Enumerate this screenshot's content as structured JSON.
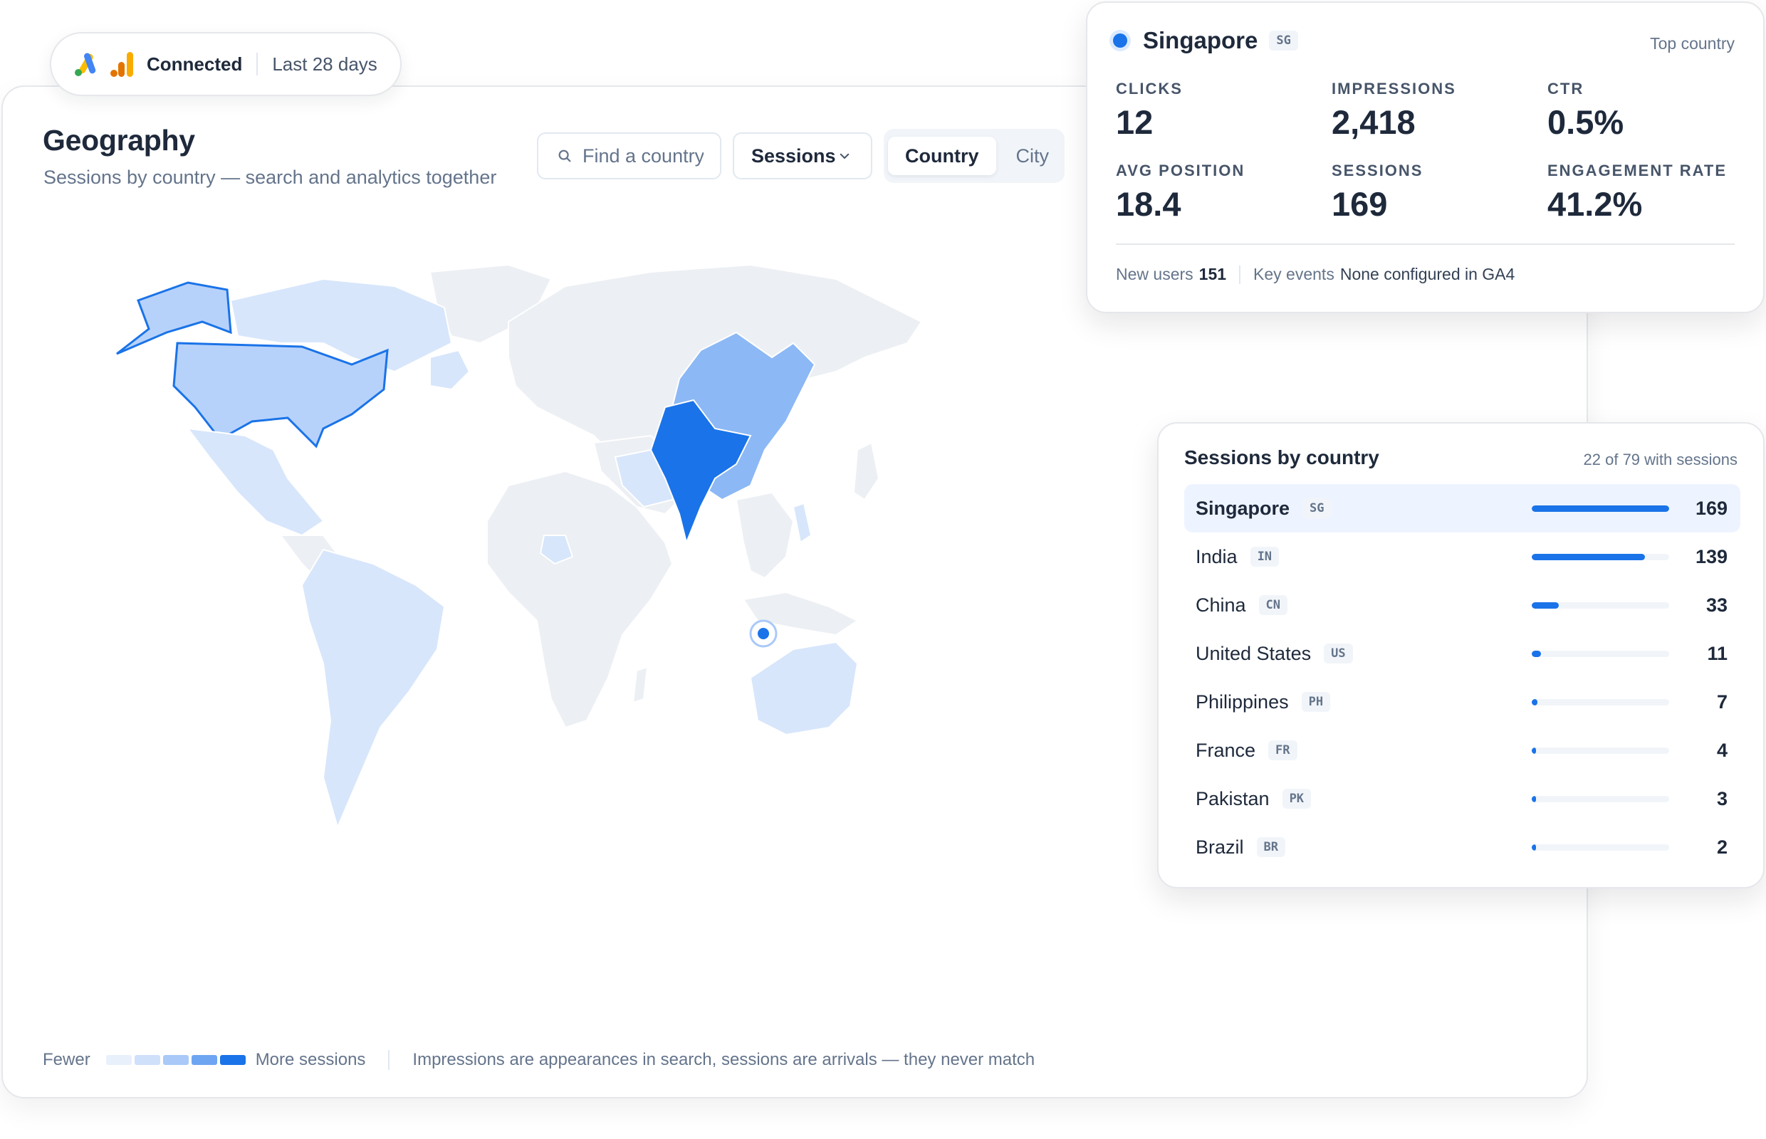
{
  "connection": {
    "status": "Connected",
    "range": "Last 28 days"
  },
  "header": {
    "title": "Geography",
    "subtitle": "Sessions by country — search and analytics together"
  },
  "toolbar": {
    "search_placeholder": "Find a country",
    "metric_select": "Sessions",
    "view_tabs": [
      {
        "label": "Country",
        "active": true
      },
      {
        "label": "City",
        "active": false
      }
    ]
  },
  "colors": {
    "accent": "#1a73e8",
    "scale": [
      "#e8f0fc",
      "#cfe0fb",
      "#a9c9f8",
      "#6ea5f2",
      "#1a73e8"
    ],
    "land_base": "#eceff3"
  },
  "top_country": {
    "name": "Singapore",
    "code": "SG",
    "tag": "Top country",
    "metrics": [
      {
        "label": "CLICKS",
        "value": "12"
      },
      {
        "label": "IMPRESSIONS",
        "value": "2,418"
      },
      {
        "label": "CTR",
        "value": "0.5%"
      },
      {
        "label": "AVG POSITION",
        "value": "18.4"
      },
      {
        "label": "SESSIONS",
        "value": "169"
      },
      {
        "label": "ENGAGEMENT RATE",
        "value": "41.2%"
      }
    ],
    "footer": {
      "new_users_label": "New users",
      "new_users_value": "151",
      "key_events_label": "Key events",
      "key_events_value": "None configured in GA4"
    }
  },
  "country_list": {
    "title": "Sessions by country",
    "count_text": "22 of 79 with sessions",
    "max": 169,
    "rows": [
      {
        "name": "Singapore",
        "code": "SG",
        "value": 169,
        "selected": true
      },
      {
        "name": "India",
        "code": "IN",
        "value": 139,
        "selected": false
      },
      {
        "name": "China",
        "code": "CN",
        "value": 33,
        "selected": false
      },
      {
        "name": "United States",
        "code": "US",
        "value": 11,
        "selected": false
      },
      {
        "name": "Philippines",
        "code": "PH",
        "value": 7,
        "selected": false
      },
      {
        "name": "France",
        "code": "FR",
        "value": 4,
        "selected": false
      },
      {
        "name": "Pakistan",
        "code": "PK",
        "value": 3,
        "selected": false
      },
      {
        "name": "Brazil",
        "code": "BR",
        "value": 2,
        "selected": false
      }
    ]
  },
  "legend": {
    "fewer": "Fewer",
    "more": "More sessions",
    "note": "Impressions are appearances in search, sessions are arrivals — they never match"
  }
}
